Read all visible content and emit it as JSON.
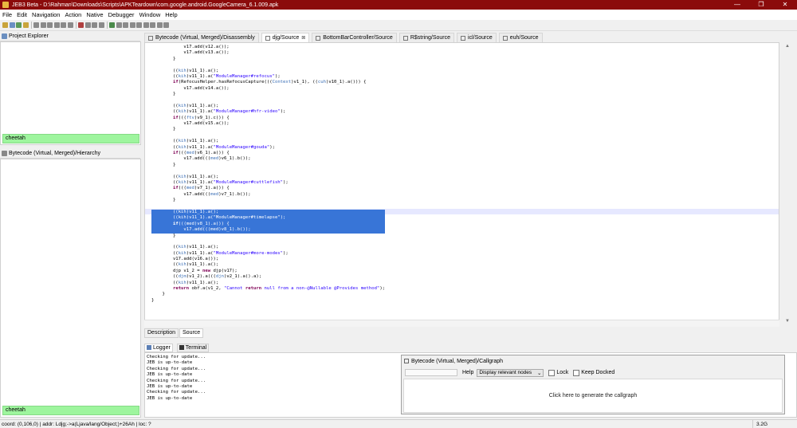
{
  "window": {
    "title": "JEB3 Beta - D:\\Rahman\\Downloads\\Scripts\\APKTeardown\\com.google.android.GoogleCamera_6.1.009.apk",
    "minimize": "—",
    "maximize": "❐",
    "close": "✕"
  },
  "menu": [
    "File",
    "Edit",
    "Navigation",
    "Action",
    "Native",
    "Debugger",
    "Window",
    "Help"
  ],
  "toolbar": {
    "colors": [
      "#c9a43b",
      "#6a8fc4",
      "#5a9a5a",
      "#c9a43b",
      "#8a8a8a",
      "#8a8a8a",
      "#8a8a8a",
      "#8a8a8a",
      "#8a8a8a",
      "#8a8a8a",
      "#b04040",
      "#8a8a8a",
      "#8a8a8a",
      "#8a8a8a",
      "#4a8a4a",
      "#8a8a8a",
      "#8a8a8a",
      "#8a8a8a",
      "#8a8a8a",
      "#8a8a8a",
      "#8a8a8a",
      "#8a8a8a",
      "#8a8a8a"
    ]
  },
  "project_explorer": {
    "title": "Project Explorer",
    "filter_value": "cheetah"
  },
  "hierarchy": {
    "title": "Bytecode (Virtual, Merged)/Hierarchy",
    "filter_value": "cheetah"
  },
  "editor_tabs": [
    {
      "label": "Bytecode (Virtual, Merged)/Disassembly",
      "active": false,
      "closable": false
    },
    {
      "label": "djg/Source",
      "active": true,
      "closable": true
    },
    {
      "label": "BottomBarController/Source",
      "active": false,
      "closable": false
    },
    {
      "label": "R$string/Source",
      "active": false,
      "closable": false
    },
    {
      "label": "icl/Source",
      "active": false,
      "closable": false
    },
    {
      "label": "euh/Source",
      "active": false,
      "closable": false
    }
  ],
  "code_lines": [
    "            v17.add(v12.a());",
    "            v17.add(v13.a());",
    "        }",
    "",
    "        ((kih)v11_1).a();",
    "        ((kih)v11_1).a(\"ModuleManager#refocus\");",
    "        if(RefocusHelper.hasRefocusCapture(((Context)v1_1), ((cuh)v10_1).a())) {",
    "            v17.add(v14.a());",
    "        }",
    "",
    "        ((kih)v11_1).a();",
    "        ((kih)v11_1).a(\"ModuleManager#hfr-video\");",
    "        if(((ftv)v9_1).c()) {",
    "            v17.add(v15.a());",
    "        }",
    "",
    "        ((kih)v11_1).a();",
    "        ((kih)v11_1).a(\"ModuleManager#gouda\");",
    "        if(((med)v6_1).a()) {",
    "            v17.add(((med)v6_1).b());",
    "        }",
    "",
    "        ((kih)v11_1).a();",
    "        ((kih)v11_1).a(\"ModuleManager#cuttlefish\");",
    "        if(((med)v7_1).a()) {",
    "            v17.add(((med)v7_1).b());",
    "        }",
    "",
    "        ((kih)v11_1).a();",
    "        ((kih)v11_1).a(\"ModuleManager#timelapse\");",
    "        if(((med)v8_1).a()) {",
    "            v17.add(((med)v8_1).b());",
    "        }",
    "",
    "        ((kih)v11_1).a();",
    "        ((kih)v11_1).a(\"ModuleManager#more-modes\");",
    "        v17.add(v16.a());",
    "        ((kih)v11_1).a();",
    "        djp v1_2 = new djp(v17);",
    "        ((djm)v1_2).a(((djn)v2_1).a().a);",
    "        ((kih)v11_1).a();",
    "        return obf.a(v1_2, \"Cannot return null from a non-@Nullable @Provides method\");",
    "    }",
    "}"
  ],
  "selected_lines": [
    28,
    29,
    30,
    31
  ],
  "subtabs": [
    "Description",
    "Source"
  ],
  "console_tabs": [
    "Logger",
    "Terminal"
  ],
  "console_lines": [
    "Checking for update...",
    "JEB is up-to-date",
    "Checking for update...",
    "JEB is up-to-date",
    "Checking for update...",
    "JEB is up-to-date",
    "Checking for update...",
    "JEB is up-to-date"
  ],
  "callgraph": {
    "title": "Bytecode (Virtual, Merged)/Callgraph",
    "help_label": "Help",
    "select_value": "Display relevant nodes",
    "lock_label": "Lock",
    "keep_docked_label": "Keep Docked",
    "body_text": "Click here to generate the callgraph"
  },
  "status": {
    "text": "coord: (0,106,0) | addr: Ldjg;->a(Ljava/lang/Object;)+26Ah | loc: ?",
    "memory": "3.2G"
  }
}
